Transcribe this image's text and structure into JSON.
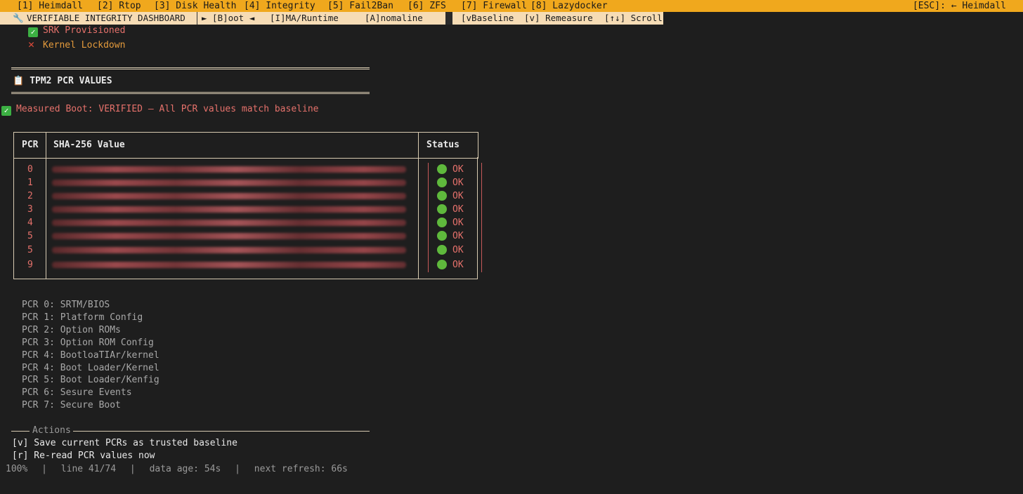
{
  "topbar": {
    "tabs": [
      "[1] Heimdall",
      "[2] Rtop",
      "[3] Disk Health",
      "[4] Integrity",
      "[5] Fail2Ban",
      "[6] ZFS",
      "[7] Firewall",
      "[8] Lazydocker"
    ],
    "esc": "[ESC]: ← Heimdall"
  },
  "subbar": {
    "title": "VERIFIABLE INTEGRITY DASHBOARD",
    "modes": [
      "► [B]oot ◄",
      "[I]MA/Runtime",
      "[A]nomaline"
    ],
    "keys": [
      "[vBaseline",
      "[v] Remeasure",
      "[↑↓] Scroll"
    ]
  },
  "checks": [
    {
      "icon": "check-icon",
      "label": "SRK Provisioned"
    },
    {
      "icon": "x-icon",
      "label": "Kernel Lockdown"
    }
  ],
  "section": {
    "icon": "clipboard-icon",
    "title": "TPM2 PCR VALUES"
  },
  "measured_boot": "Measured Boot: VERIFIED – All PCR values match baseline",
  "table": {
    "headers": [
      "PCR",
      "SHA-256 Value",
      "Status"
    ],
    "rows": [
      {
        "pcr": "0",
        "status": "OK"
      },
      {
        "pcr": "1",
        "status": "OK"
      },
      {
        "pcr": "2",
        "status": "OK"
      },
      {
        "pcr": "3",
        "status": "OK"
      },
      {
        "pcr": "4",
        "status": "OK"
      },
      {
        "pcr": "5",
        "status": "OK"
      },
      {
        "pcr": "5",
        "status": "OK"
      },
      {
        "pcr": "9",
        "status": "OK"
      }
    ]
  },
  "legend": [
    "PCR 0: SRTM/BIOS",
    "PCR 1: Platform Config",
    "PCR 2: Option ROMs",
    "PCR 3: Option ROM Config",
    "PCR 4: BootloaTIAr/kernel",
    "PCR 4: Boot Loader/Kernel",
    "PCR 5: Boot Loader/Kenfig",
    "PCR 6: Sesure Events",
    "PCR 7: Secure Boot"
  ],
  "actions": {
    "title": "Actions",
    "items": [
      "[v] Save current PCRs as trusted baseline",
      "[r] Re-read PCR values now"
    ]
  },
  "status": {
    "zoom": "100%",
    "line": "line 41/74",
    "age": "data age: 54s",
    "refresh": "next refresh: 66s"
  },
  "colors": {
    "accent": "#f0a81d",
    "ok_dot": "#5fb93c",
    "red_text": "#e5716b"
  }
}
